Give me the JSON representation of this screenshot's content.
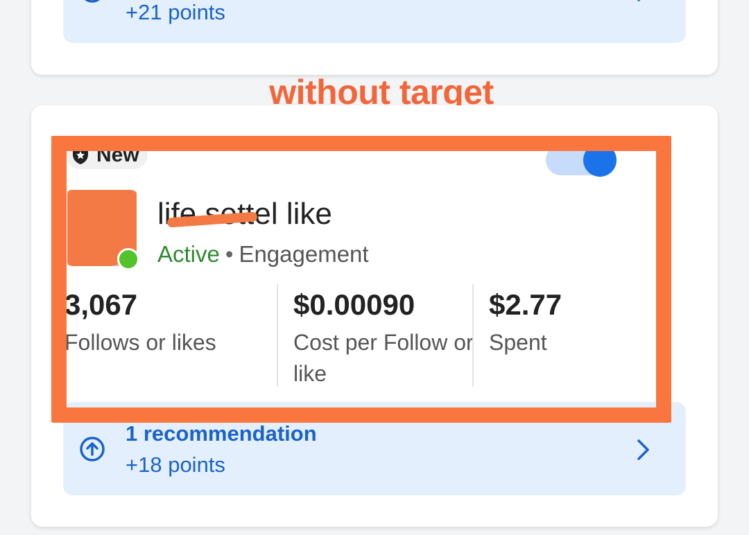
{
  "top_card": {
    "recommendation_points": "+21 points"
  },
  "annotation": {
    "label": "without target",
    "color": "#f9773f"
  },
  "campaign": {
    "badge": "New",
    "name": "life settel like",
    "status": "Active",
    "separator": "•",
    "objective": "Engagement",
    "toggle_on": true,
    "metrics": [
      {
        "value": "3,067",
        "label": "Follows or likes"
      },
      {
        "value": "$0.00090",
        "label": "Cost per Follow or like"
      },
      {
        "value": "$2.77",
        "label": "Spent"
      }
    ],
    "recommendation": {
      "title": "1 recommendation",
      "points": "+18 points"
    }
  },
  "colors": {
    "accent_blue": "#1a73e8",
    "link_blue": "#1a63c9",
    "active_green": "#2e8b2e",
    "rec_background": "#e4effd"
  },
  "icons": {
    "recommendation": "arrow-up-circle-icon",
    "chevron": "chevron-right-icon",
    "badge": "shield-star-icon"
  }
}
